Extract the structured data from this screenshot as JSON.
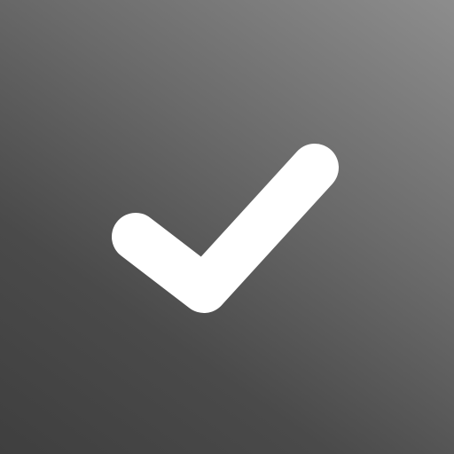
{
  "icon": {
    "name": "checkmark-icon",
    "stroke_color": "#ffffff"
  },
  "background": {
    "gradient_start": "#3f3f3f",
    "gradient_end": "#8d8d8d"
  }
}
